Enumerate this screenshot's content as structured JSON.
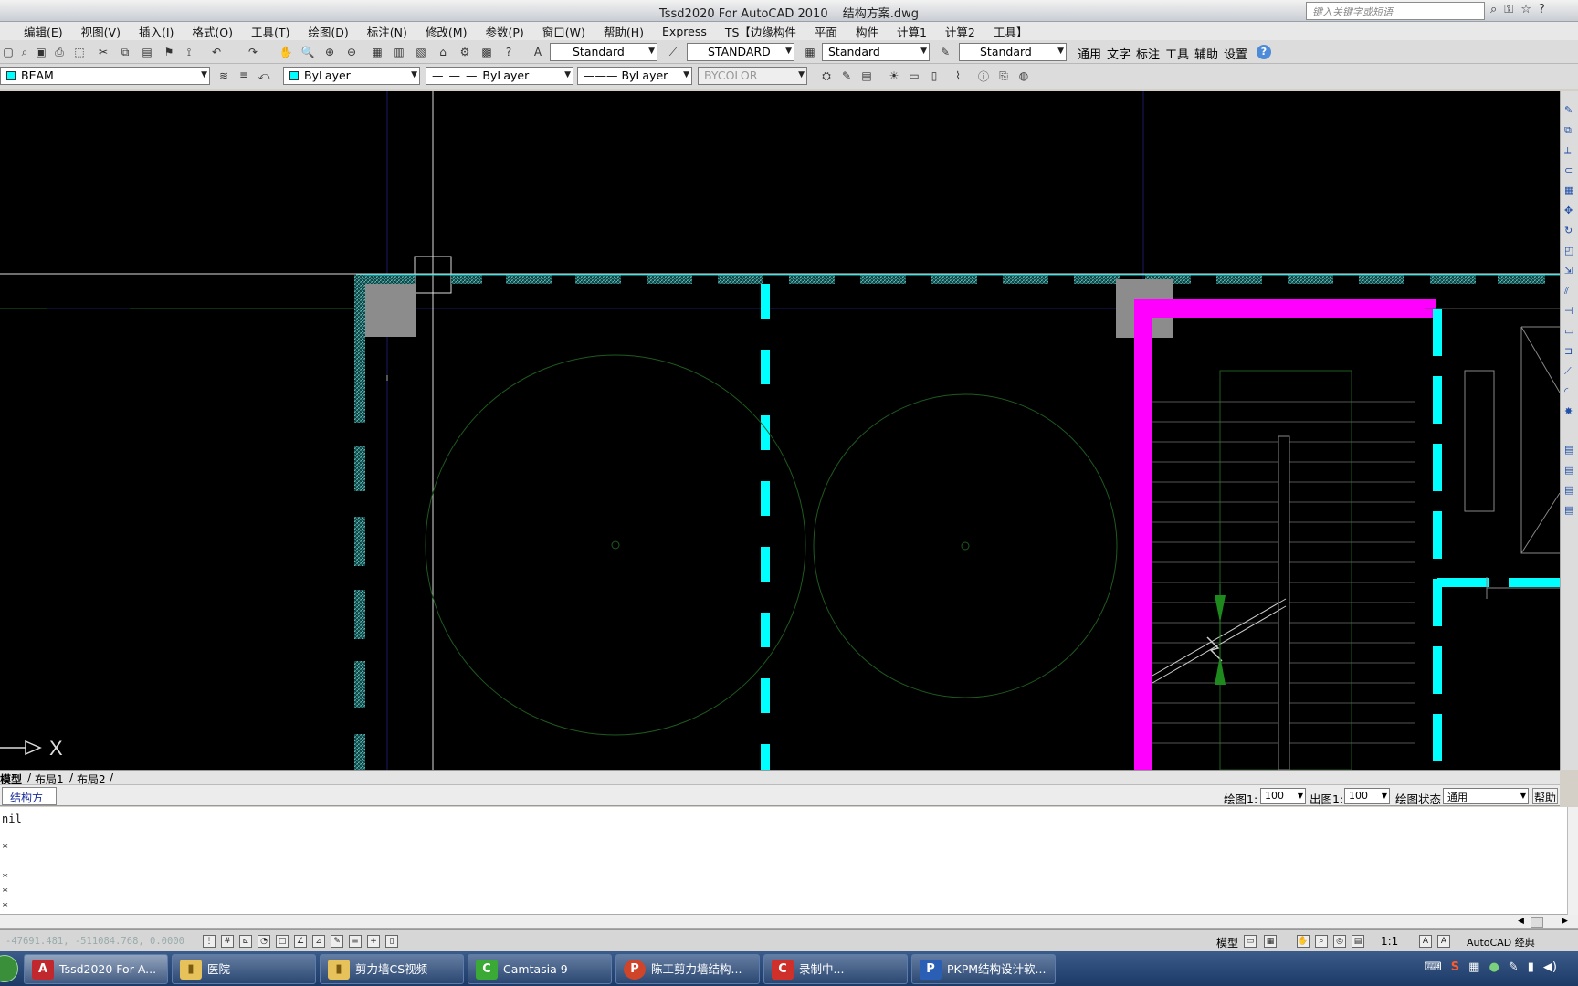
{
  "window": {
    "app": "Tssd2020 For AutoCAD 2010",
    "file": "结构方案.dwg",
    "search_placeholder": "键入关键字或短语"
  },
  "menu": [
    "编辑(E)",
    "视图(V)",
    "插入(I)",
    "格式(O)",
    "工具(T)",
    "绘图(D)",
    "标注(N)",
    "修改(M)",
    "参数(P)",
    "窗口(W)",
    "帮助(H)",
    "Express",
    "TS【边缘构件",
    "平面",
    "构件",
    "计算1",
    "计算2",
    "工具】"
  ],
  "toolbar1": {
    "text_style": "Standard",
    "dim_style": "STANDARD",
    "table_style": "Standard",
    "multileader_style": "Standard",
    "tabs": [
      "通用",
      "文字",
      "标注",
      "工具",
      "辅助",
      "设置"
    ]
  },
  "toolbar2": {
    "layer": "BEAM",
    "color": "ByLayer",
    "linetype": "ByLayer",
    "lineweight": "ByLayer",
    "plotstyle": "BYCOLOR",
    "layer_color": "#00ffff"
  },
  "canvas": {
    "ucs_x_label": "X",
    "colors": {
      "wall": "#00ffff",
      "highlight": "#ff00ff",
      "column": "#8c8c8c",
      "thin_line": "#1e5a1e",
      "axis": "#1a1a66"
    }
  },
  "layout_tabs": [
    "模型",
    "布局1",
    "布局2"
  ],
  "scale_bar": {
    "drawing_tab": "结构方案",
    "draw_scale_label": "绘图1:",
    "draw_scale_value": "100",
    "output_scale_label": "出图1:",
    "output_scale_value": "100",
    "draw_state_label": "绘图状态",
    "draw_state_value": "通用",
    "help_label": "帮助"
  },
  "command_lines": [
    "nil",
    "*",
    "*",
    "*",
    "*"
  ],
  "status": {
    "coords": "-47691.481, -511084.768, 0.0000",
    "model_label": "模型",
    "annotation_scale": "1:1",
    "workspace": "AutoCAD 经典"
  },
  "taskbar": [
    {
      "label": "Tssd2020 For A...",
      "color": "#c0282d",
      "glyph": "A"
    },
    {
      "label": "医院",
      "color": "#e7c15a",
      "glyph": "▮"
    },
    {
      "label": "剪力墙CS视频",
      "color": "#e7c15a",
      "glyph": "▮"
    },
    {
      "label": "Camtasia 9",
      "color": "#3aa935",
      "glyph": "C"
    },
    {
      "label": "陈工剪力墙结构...",
      "color": "#d0442a",
      "glyph": "P"
    },
    {
      "label": "录制中...",
      "color": "#d0302a",
      "glyph": "C"
    },
    {
      "label": "PKPM结构设计软...",
      "color": "#2a5fb5",
      "glyph": "P"
    }
  ]
}
